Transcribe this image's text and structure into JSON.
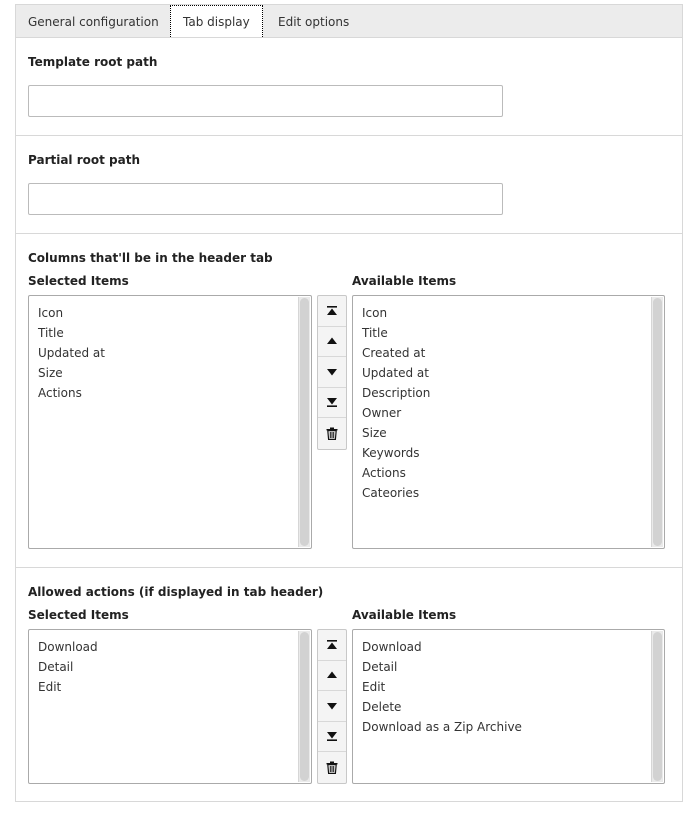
{
  "tabs": [
    {
      "label": "General configuration"
    },
    {
      "label": "Tab display"
    },
    {
      "label": "Edit options"
    }
  ],
  "template_root": {
    "label": "Template root path",
    "value": ""
  },
  "partial_root": {
    "label": "Partial root path",
    "value": ""
  },
  "columns": {
    "label": "Columns that'll be in the header tab",
    "selected_label": "Selected Items",
    "available_label": "Available Items",
    "selected": [
      "Icon",
      "Title",
      "Updated at",
      "Size",
      "Actions"
    ],
    "available": [
      "Icon",
      "Title",
      "Created at",
      "Updated at",
      "Description",
      "Owner",
      "Size",
      "Keywords",
      "Actions",
      "Cateories"
    ]
  },
  "actions": {
    "label": "Allowed actions (if displayed in tab header)",
    "selected_label": "Selected Items",
    "available_label": "Available Items",
    "selected": [
      "Download",
      "Detail",
      "Edit"
    ],
    "available": [
      "Download",
      "Detail",
      "Edit",
      "Delete",
      "Download as a Zip Archive"
    ]
  },
  "icons": {
    "move_top": "move-to-top-icon",
    "move_up": "move-up-icon",
    "move_down": "move-down-icon",
    "move_bottom": "move-to-bottom-icon",
    "remove": "trash-icon"
  }
}
